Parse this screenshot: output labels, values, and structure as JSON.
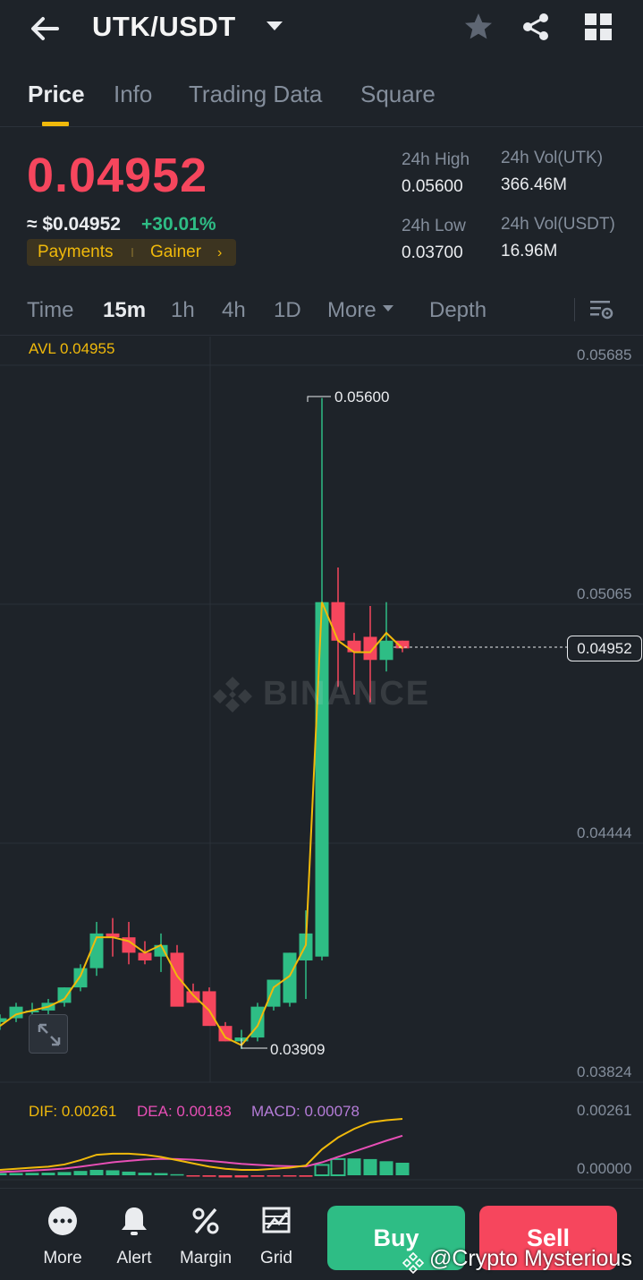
{
  "header": {
    "pair": "UTK/USDT",
    "icons": [
      "back-arrow-icon",
      "dropdown-caret-icon",
      "star-icon",
      "share-icon",
      "grid-icon"
    ]
  },
  "tabs": [
    "Price",
    "Info",
    "Trading Data",
    "Square"
  ],
  "summary": {
    "last_price": "0.04952",
    "usd_price": "≈ $0.04952",
    "change": "+30.01%",
    "tags": [
      "Payments",
      "Gainer"
    ],
    "high_label": "24h High",
    "high_value": "0.05600",
    "low_label": "24h Low",
    "low_value": "0.03700",
    "vol_base_label": "24h Vol(UTK)",
    "vol_base_value": "366.46M",
    "vol_quote_label": "24h Vol(USDT)",
    "vol_quote_value": "16.96M"
  },
  "intervals": {
    "items": [
      "Time",
      "15m",
      "1h",
      "4h",
      "1D",
      "More",
      "Depth"
    ],
    "active": "15m"
  },
  "chart_meta": {
    "avl": "AVL 0.04955",
    "axis": [
      "0.05685",
      "0.05065",
      "0.04444",
      "0.03824"
    ],
    "last_price_marker": "0.04952",
    "high_marker": "0.05600",
    "low_marker": "0.03909",
    "watermark": "BINANCE"
  },
  "macd": {
    "dif": "DIF: 0.00261",
    "dea": "DEA: 0.00183",
    "macd": "MACD: 0.00078",
    "axis": [
      "0.00261",
      "0.00000"
    ]
  },
  "colors": {
    "up": "#2ebd85",
    "down": "#f6465d",
    "accent": "#f0b90b",
    "dea": "#e84fb6",
    "macd": "#b57cd8",
    "background": "#1e2329"
  },
  "chart_data": {
    "type": "candlestick",
    "interval": "15m",
    "y_axis": [
      0.05685,
      0.05065,
      0.04444,
      0.03824
    ],
    "candles": [
      {
        "o": 0.0398,
        "h": 0.04,
        "l": 0.0396,
        "c": 0.0399
      },
      {
        "o": 0.0399,
        "h": 0.0403,
        "l": 0.0398,
        "c": 0.0402
      },
      {
        "o": 0.0401,
        "h": 0.0403,
        "l": 0.04,
        "c": 0.0401
      },
      {
        "o": 0.0401,
        "h": 0.0404,
        "l": 0.04,
        "c": 0.0403
      },
      {
        "o": 0.0403,
        "h": 0.0407,
        "l": 0.0402,
        "c": 0.0407
      },
      {
        "o": 0.0407,
        "h": 0.0413,
        "l": 0.0406,
        "c": 0.0412
      },
      {
        "o": 0.0412,
        "h": 0.0424,
        "l": 0.041,
        "c": 0.0421
      },
      {
        "o": 0.0421,
        "h": 0.0425,
        "l": 0.0415,
        "c": 0.042
      },
      {
        "o": 0.042,
        "h": 0.0424,
        "l": 0.0413,
        "c": 0.0416
      },
      {
        "o": 0.0416,
        "h": 0.0419,
        "l": 0.0413,
        "c": 0.0414
      },
      {
        "o": 0.0415,
        "h": 0.0421,
        "l": 0.0411,
        "c": 0.0418
      },
      {
        "o": 0.0416,
        "h": 0.0418,
        "l": 0.041,
        "c": 0.0402
      },
      {
        "o": 0.0406,
        "h": 0.0408,
        "l": 0.0403,
        "c": 0.0403
      },
      {
        "o": 0.0406,
        "h": 0.0407,
        "l": 0.0398,
        "c": 0.0397
      },
      {
        "o": 0.0397,
        "h": 0.0398,
        "l": 0.0393,
        "c": 0.0393
      },
      {
        "o": 0.0393,
        "h": 0.0396,
        "l": 0.0391,
        "c": 0.0394
      },
      {
        "o": 0.0394,
        "h": 0.0403,
        "l": 0.0393,
        "c": 0.0402
      },
      {
        "o": 0.0402,
        "h": 0.0407,
        "l": 0.0401,
        "c": 0.0409
      },
      {
        "o": 0.0403,
        "h": 0.0416,
        "l": 0.0402,
        "c": 0.0416
      },
      {
        "o": 0.0414,
        "h": 0.0427,
        "l": 0.0404,
        "c": 0.0421
      },
      {
        "o": 0.0415,
        "h": 0.056,
        "l": 0.0414,
        "c": 0.0507
      },
      {
        "o": 0.0507,
        "h": 0.0516,
        "l": 0.0485,
        "c": 0.0497
      },
      {
        "o": 0.0497,
        "h": 0.0499,
        "l": 0.0483,
        "c": 0.0494
      },
      {
        "o": 0.0498,
        "h": 0.0506,
        "l": 0.0481,
        "c": 0.0492
      },
      {
        "o": 0.0492,
        "h": 0.0507,
        "l": 0.0489,
        "c": 0.0497
      },
      {
        "o": 0.0497,
        "h": 0.0497,
        "l": 0.0494,
        "c": 0.0495
      }
    ],
    "avl_line": [
      0.0397,
      0.04,
      0.0401,
      0.0402,
      0.0404,
      0.041,
      0.042,
      0.042,
      0.0419,
      0.0416,
      0.0418,
      0.041,
      0.0405,
      0.0401,
      0.0394,
      0.0392,
      0.0397,
      0.0407,
      0.041,
      0.0418,
      0.0507,
      0.0497,
      0.0494,
      0.0494,
      0.0499,
      0.0495
    ],
    "macd_hist": [
      0.0001,
      0.0001,
      0.00011,
      0.00012,
      0.00015,
      0.0002,
      0.00025,
      0.00023,
      0.00017,
      0.00012,
      0.0001,
      5e-05,
      -3e-05,
      -7e-05,
      -0.0001,
      -0.0001,
      -7e-05,
      -4e-05,
      -3e-05,
      -7e-05,
      0.00048,
      0.00075,
      0.00078,
      0.00075,
      0.00065,
      0.00058
    ],
    "dif_line": [
      0.00025,
      0.0003,
      0.00035,
      0.0004,
      0.0005,
      0.0007,
      0.00095,
      0.001,
      0.001,
      0.00095,
      0.00085,
      0.0007,
      0.00055,
      0.0004,
      0.0003,
      0.00025,
      0.00025,
      0.0003,
      0.00035,
      0.00045,
      0.0012,
      0.00175,
      0.00215,
      0.00245,
      0.00255,
      0.00261
    ],
    "dea_line": [
      0.00015,
      0.00018,
      0.00022,
      0.00026,
      0.00031,
      0.0004,
      0.0005,
      0.0006,
      0.00067,
      0.00073,
      0.00076,
      0.00075,
      0.00072,
      0.00067,
      0.0006,
      0.00053,
      0.00048,
      0.00044,
      0.00042,
      0.00041,
      0.0006,
      0.00085,
      0.0011,
      0.00135,
      0.0016,
      0.00183
    ],
    "annotations": {
      "high": 0.056,
      "low": 0.03909,
      "last": 0.04952
    }
  },
  "bottom_nav": {
    "items": [
      {
        "label": "More",
        "icon": "more-dots-icon"
      },
      {
        "label": "Alert",
        "icon": "bell-icon"
      },
      {
        "label": "Margin",
        "icon": "percent-icon"
      },
      {
        "label": "Grid",
        "icon": "grid-trading-icon"
      }
    ],
    "buy": "Buy",
    "sell": "Sell"
  },
  "credit": "@Crypto Mysterious"
}
